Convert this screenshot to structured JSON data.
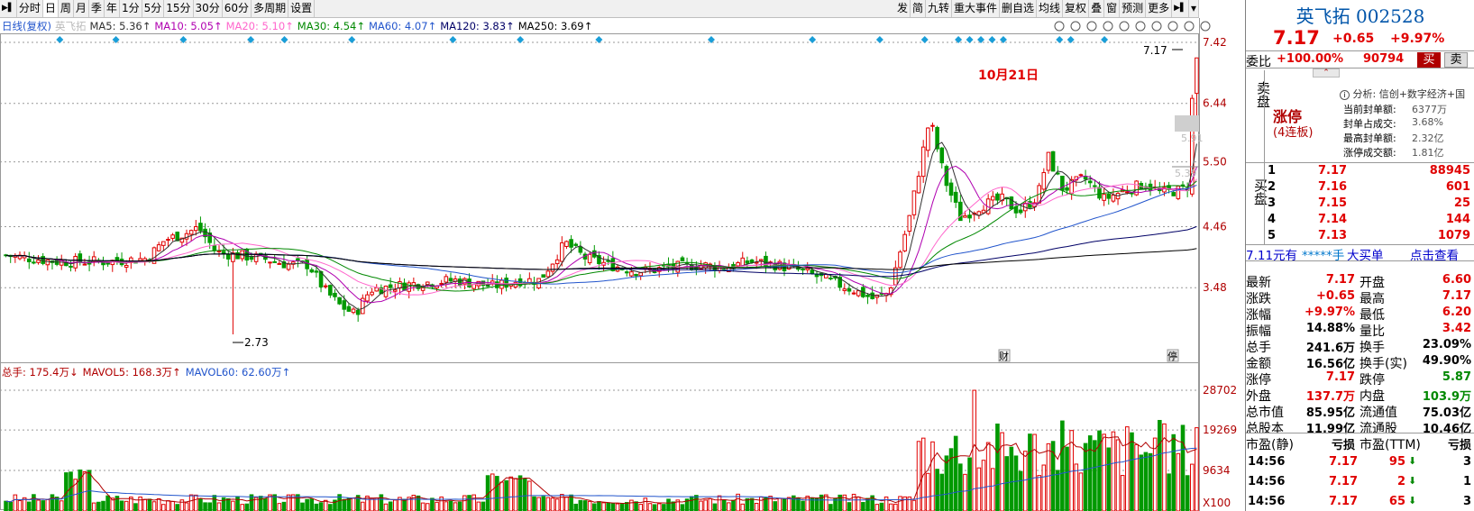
{
  "toolbar": {
    "items": [
      "分时",
      "日",
      "周",
      "月",
      "季",
      "年",
      "1分",
      "5分",
      "15分",
      "30分",
      "60分",
      "多周期",
      "设置"
    ],
    "right": [
      "发",
      "简",
      "九转",
      "重大事件",
      "删自选",
      "均线",
      "复权",
      "叠",
      "窗",
      "预测",
      "更多"
    ]
  },
  "infobar": {
    "label": "日线(复权)",
    "name": "英飞拓",
    "ma": [
      {
        "t": "MA5: 5.36↑",
        "c": "#303030"
      },
      {
        "t": "MA10: 5.05↑",
        "c": "#b000b0"
      },
      {
        "t": "MA20: 5.10↑",
        "c": "#ff66cc"
      },
      {
        "t": "MA30: 4.54↑",
        "c": "#008800"
      },
      {
        "t": "MA60: 4.07↑",
        "c": "#2255cc"
      },
      {
        "t": "MA120: 3.83↑",
        "c": "#000066"
      },
      {
        "t": "MA250: 3.69↑",
        "c": "#000000"
      }
    ]
  },
  "price_axis": {
    "ticks": [
      "7.42",
      "6.44",
      "5.50",
      "4.46",
      "3.48"
    ]
  },
  "annotations": {
    "date": "10月21日",
    "last": "7.17",
    "low": "2.73",
    "tag1": "5.91",
    "tag2": "5.39",
    "mark1": "财",
    "mark2": "停"
  },
  "volbar": {
    "items": [
      {
        "t": "总手: 175.4万↓",
        "c": "#b00000"
      },
      {
        "t": "MAVOL5: 168.3万↑",
        "c": "#b00000"
      },
      {
        "t": "MAVOL60: 62.60万↑",
        "c": "#2255cc"
      }
    ]
  },
  "vol_axis": {
    "ticks": [
      "28702",
      "19269",
      "9634"
    ],
    "unit": "X100"
  },
  "chart_data": {
    "type": "candlestick",
    "price_range": [
      2.6,
      7.55
    ],
    "axis_ticks": [
      7.42,
      6.44,
      5.5,
      4.46,
      3.48
    ],
    "visible_points": {
      "high": 7.17,
      "low": 2.73
    },
    "volume_axis_ticks": [
      28702,
      19269,
      9634
    ],
    "volume_unit": "X100",
    "ma": {
      "MA5": 5.36,
      "MA10": 5.05,
      "MA20": 5.1,
      "MA30": 4.54,
      "MA60": 4.07,
      "MA120": 3.83,
      "MA250": 3.69
    }
  },
  "panel": {
    "name": "英飞拓",
    "code": "002528",
    "price": "7.17",
    "change": "+0.65",
    "pct": "+9.97%",
    "wb_label": "委比",
    "wb_pct": "+100.00%",
    "wb_num": "90794",
    "buy_btn": "买",
    "sell_btn": "卖",
    "sell_side": "卖盘",
    "limit": "涨停",
    "limit_sub": "(4连板)",
    "analysis": "分析: 信创+数字经济+国",
    "stats": [
      [
        "当前封单额:",
        "6377万"
      ],
      [
        "封单占成交:",
        "3.68%"
      ],
      [
        "最高封单额:",
        "2.32亿"
      ],
      [
        "涨停成交额:",
        "1.81亿"
      ]
    ],
    "buy_side": "买盘",
    "bids": [
      [
        "1",
        "7.17",
        "88945"
      ],
      [
        "2",
        "7.16",
        "601"
      ],
      [
        "3",
        "7.15",
        "25"
      ],
      [
        "4",
        "7.14",
        "144"
      ],
      [
        "5",
        "7.13",
        "1079"
      ]
    ],
    "big_order": {
      "a": "7.11元有",
      "b": "*****手",
      "c": "大买单",
      "d": "点击查看"
    },
    "quote": [
      [
        "最新",
        "7.17",
        "red",
        "开盘",
        "6.60",
        "red"
      ],
      [
        "涨跌",
        "+0.65",
        "red",
        "最高",
        "7.17",
        "red"
      ],
      [
        "涨幅",
        "+9.97%",
        "red",
        "最低",
        "6.20",
        "red"
      ],
      [
        "振幅",
        "14.88%",
        "blk",
        "量比",
        "3.42",
        "red"
      ],
      [
        "总手",
        "241.6万",
        "blk",
        "换手",
        "23.09%",
        "blk"
      ],
      [
        "金额",
        "16.56亿",
        "blk",
        "换手(实)",
        "49.90%",
        "blk"
      ],
      [
        "涨停",
        "7.17",
        "red",
        "跌停",
        "5.87",
        "green"
      ],
      [
        "外盘",
        "137.7万",
        "red",
        "内盘",
        "103.9万",
        "green"
      ],
      [
        "总市值",
        "85.95亿",
        "blk",
        "流通值",
        "75.03亿",
        "blk"
      ],
      [
        "总股本",
        "11.99亿",
        "blk",
        "流通股",
        "10.46亿",
        "blk"
      ],
      [
        "市盈(静)",
        "亏损",
        "blk",
        "市盈(TTM)",
        "亏损",
        "blk"
      ]
    ],
    "ticks": [
      [
        "14:56",
        "7.17",
        "95",
        "3"
      ],
      [
        "14:56",
        "7.17",
        "2",
        "1"
      ],
      [
        "14:56",
        "7.17",
        "65",
        "3"
      ]
    ]
  }
}
